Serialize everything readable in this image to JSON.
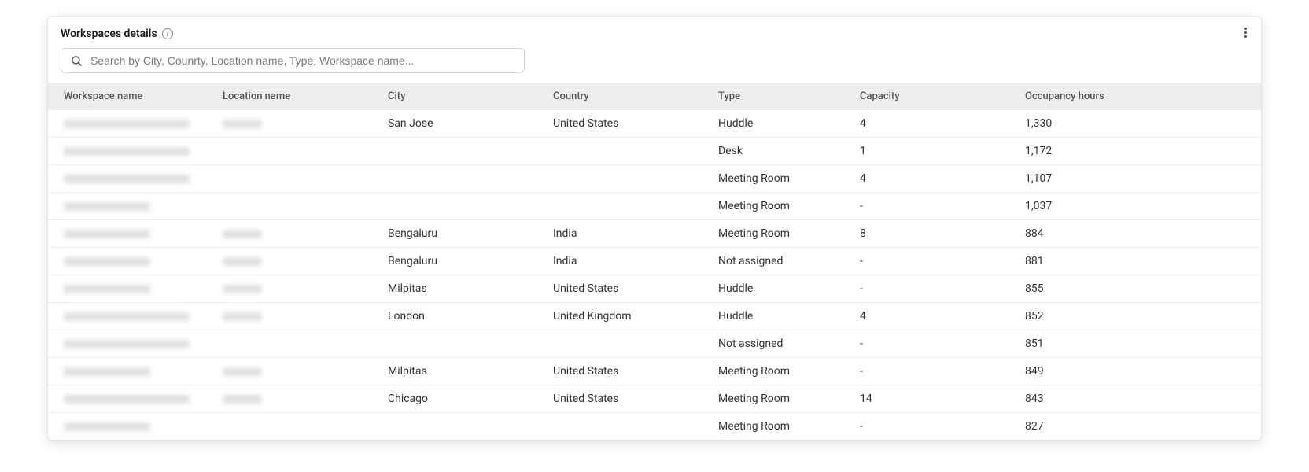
{
  "header": {
    "title": "Workspaces details"
  },
  "search": {
    "placeholder": "Search by City, Counrty, Location name, Type, Workspace name..."
  },
  "table": {
    "columns": {
      "workspace_name": "Workspace name",
      "location_name": "Location name",
      "city": "City",
      "country": "Country",
      "type": "Type",
      "capacity": "Capacity",
      "occupancy_hours": "Occupancy hours"
    },
    "rows": [
      {
        "city": "San Jose",
        "country": "United States",
        "type": "Huddle",
        "capacity": "4",
        "occupancy_hours": "1,330"
      },
      {
        "city": "",
        "country": "",
        "type": "Desk",
        "capacity": "1",
        "occupancy_hours": "1,172"
      },
      {
        "city": "",
        "country": "",
        "type": "Meeting Room",
        "capacity": "4",
        "occupancy_hours": "1,107"
      },
      {
        "city": "",
        "country": "",
        "type": "Meeting Room",
        "capacity": "-",
        "occupancy_hours": "1,037"
      },
      {
        "city": "Bengaluru",
        "country": "India",
        "type": "Meeting Room",
        "capacity": "8",
        "occupancy_hours": "884"
      },
      {
        "city": "Bengaluru",
        "country": "India",
        "type": "Not assigned",
        "capacity": "-",
        "occupancy_hours": "881"
      },
      {
        "city": "Milpitas",
        "country": "United States",
        "type": "Huddle",
        "capacity": "-",
        "occupancy_hours": "855"
      },
      {
        "city": "London",
        "country": "United Kingdom",
        "type": "Huddle",
        "capacity": "4",
        "occupancy_hours": "852"
      },
      {
        "city": "",
        "country": "",
        "type": "Not assigned",
        "capacity": "-",
        "occupancy_hours": "851"
      },
      {
        "city": "Milpitas",
        "country": "United States",
        "type": "Meeting Room",
        "capacity": "-",
        "occupancy_hours": "849"
      },
      {
        "city": "Chicago",
        "country": "United States",
        "type": "Meeting Room",
        "capacity": "14",
        "occupancy_hours": "843"
      },
      {
        "city": "",
        "country": "",
        "type": "Meeting Room",
        "capacity": "-",
        "occupancy_hours": "827"
      }
    ]
  }
}
